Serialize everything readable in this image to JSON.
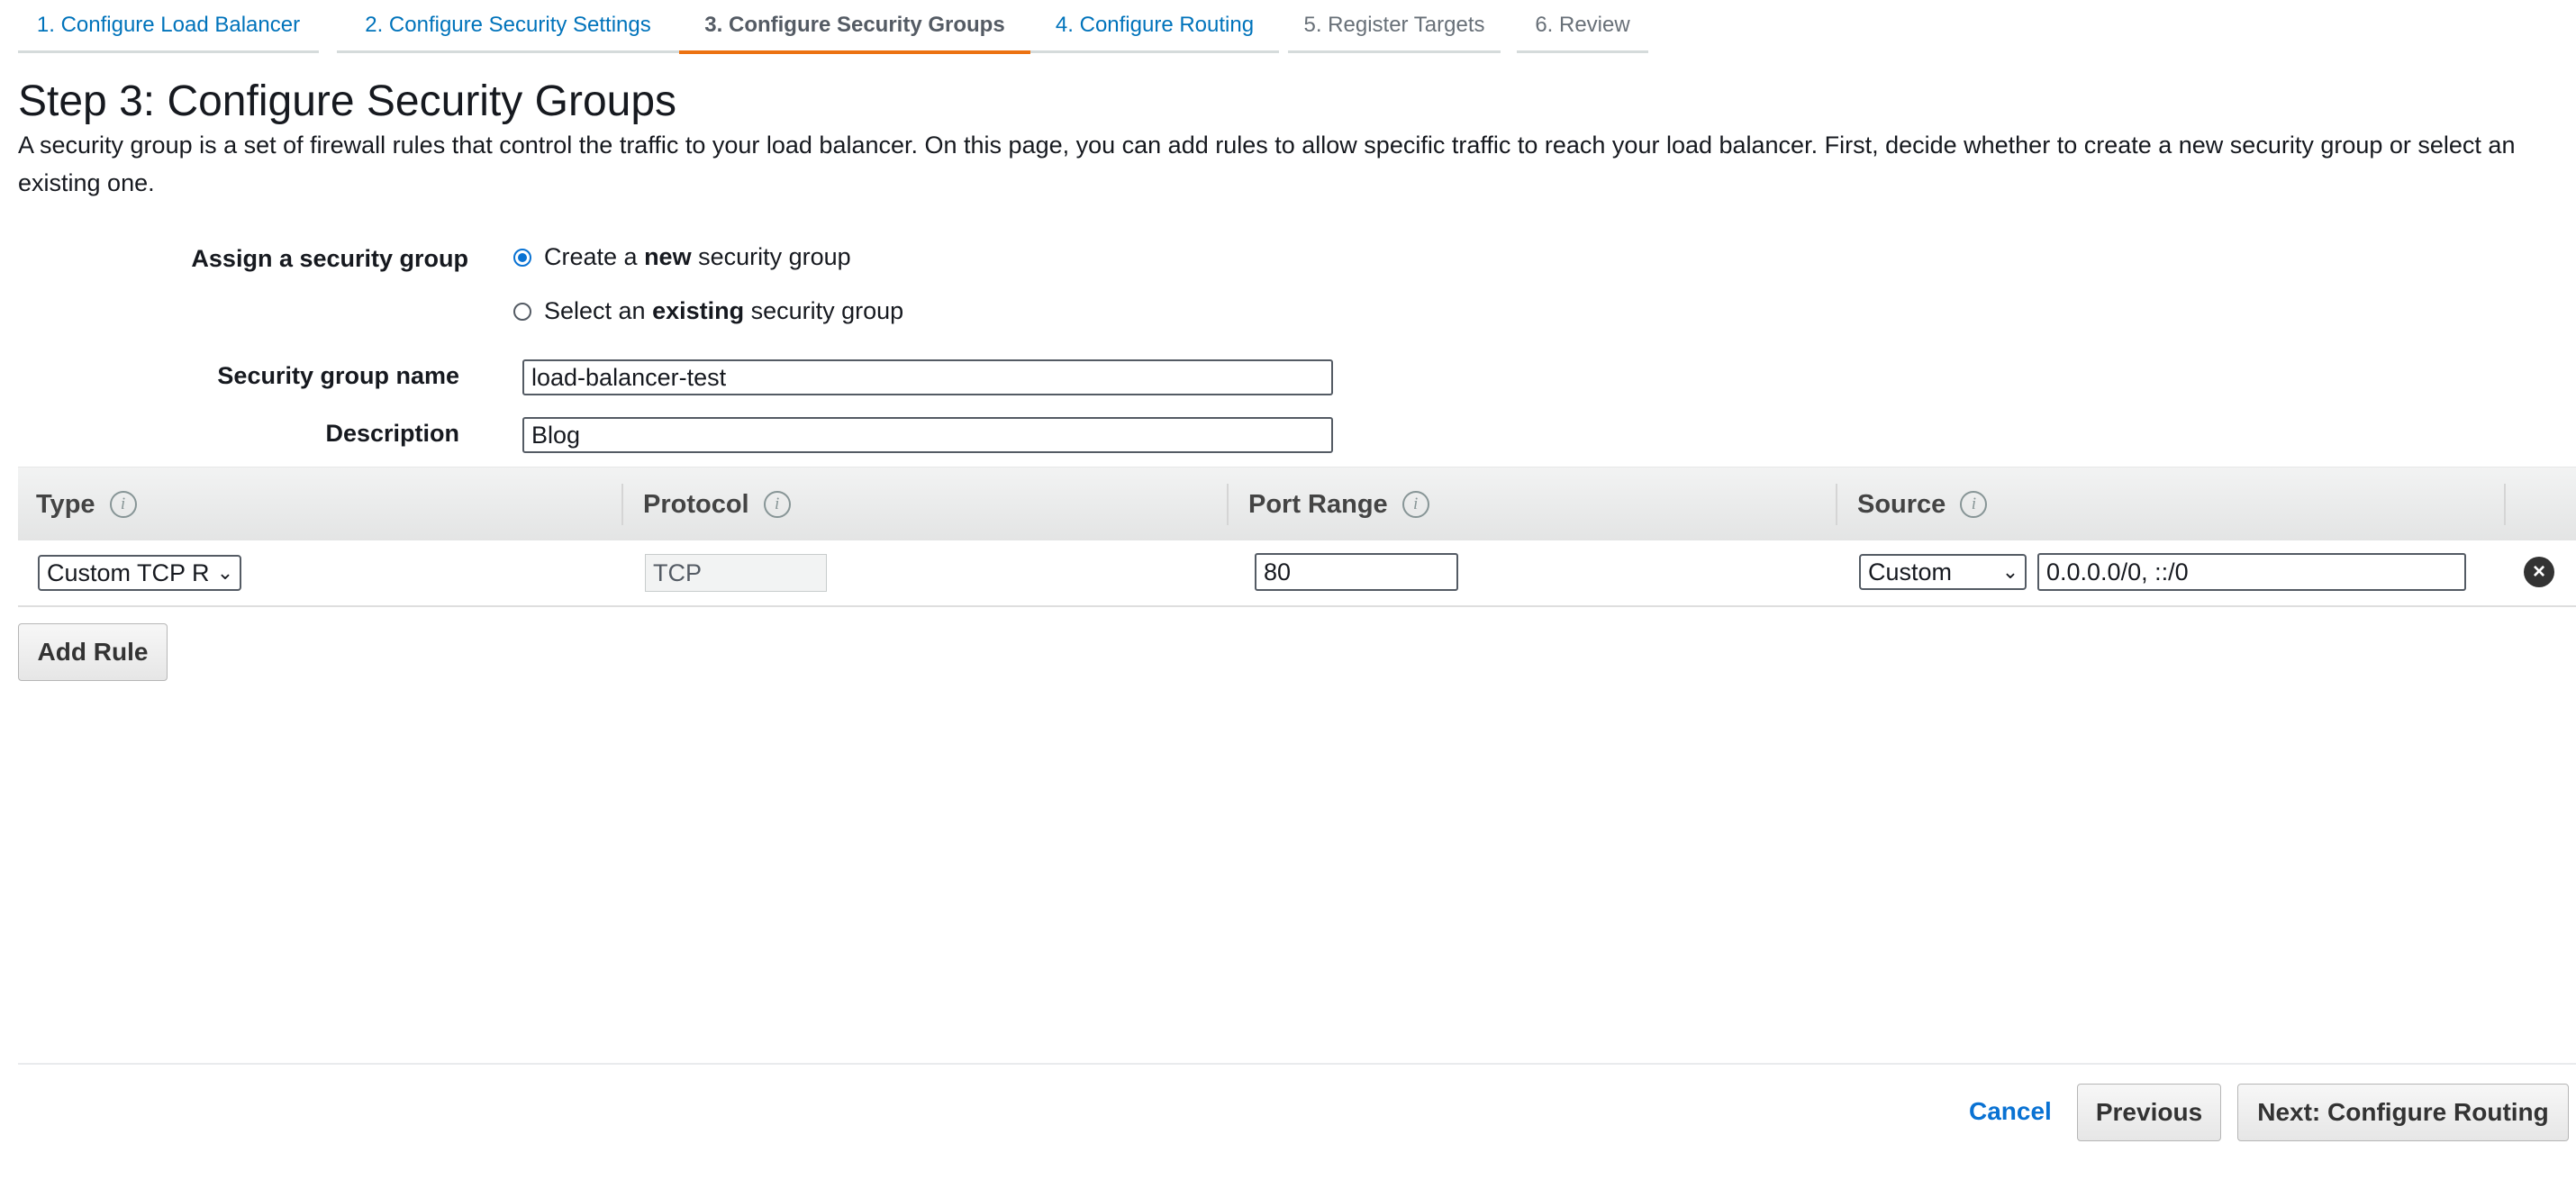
{
  "wizard": {
    "tabs": [
      {
        "label": "1. Configure Load Balancer",
        "state": "link"
      },
      {
        "label": "2. Configure Security Settings",
        "state": "link"
      },
      {
        "label": "3. Configure Security Groups",
        "state": "active"
      },
      {
        "label": "4. Configure Routing",
        "state": "link"
      },
      {
        "label": "5. Register Targets",
        "state": "disabled"
      },
      {
        "label": "6. Review",
        "state": "disabled"
      }
    ]
  },
  "page": {
    "title": "Step 3: Configure Security Groups",
    "description": "A security group is a set of firewall rules that control the traffic to your load balancer. On this page, you can add rules to allow specific traffic to reach your load balancer. First, decide whether to create a new security group or select an existing one."
  },
  "form": {
    "assign_label": "Assign a security group",
    "options": {
      "create": {
        "prefix": "Create a ",
        "bold": "new",
        "suffix": " security group",
        "selected": true
      },
      "select": {
        "prefix": "Select an ",
        "bold": "existing",
        "suffix": " security group",
        "selected": false
      }
    },
    "name_label": "Security group name",
    "name_value": "load-balancer-test",
    "description_label": "Description",
    "description_value": "Blog"
  },
  "rules_table": {
    "columns": [
      "Type",
      "Protocol",
      "Port Range",
      "Source"
    ],
    "info_icon_glyph": "i",
    "rows": [
      {
        "type": "Custom TCP R",
        "protocol": "TCP",
        "port_range": "80",
        "source_mode": "Custom",
        "source_value": "0.0.0.0/0, ::/0"
      }
    ],
    "add_rule_label": "Add Rule"
  },
  "footer": {
    "cancel_label": "Cancel",
    "previous_label": "Previous",
    "next_label": "Next: Configure Routing"
  },
  "colors": {
    "accent_tab": "#ec7211",
    "link": "#0073bb",
    "primary_blue": "#0972d3"
  }
}
